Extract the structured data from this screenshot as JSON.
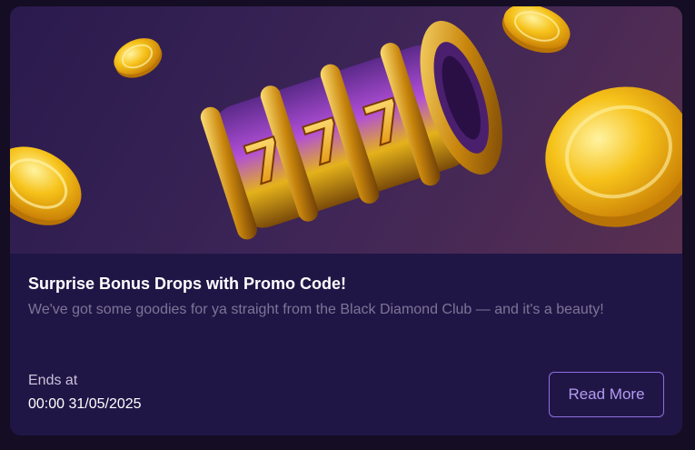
{
  "promo": {
    "title": "Surprise Bonus Drops with Promo Code!",
    "description": "We've got some goodies for ya straight from the Black Diamond Club — and it's a beauty!",
    "ends_label": "Ends at",
    "ends_value": "00:00 31/05/2025",
    "cta_label": "Read More",
    "banner_icons": [
      "slot-machine-reel-icon",
      "gold-coin-icon"
    ]
  },
  "colors": {
    "card_background": "#201646",
    "page_background": "#140d24",
    "accent_border": "#8c6fe0",
    "accent_text": "#b39af0",
    "muted_text": "#7d7596"
  }
}
